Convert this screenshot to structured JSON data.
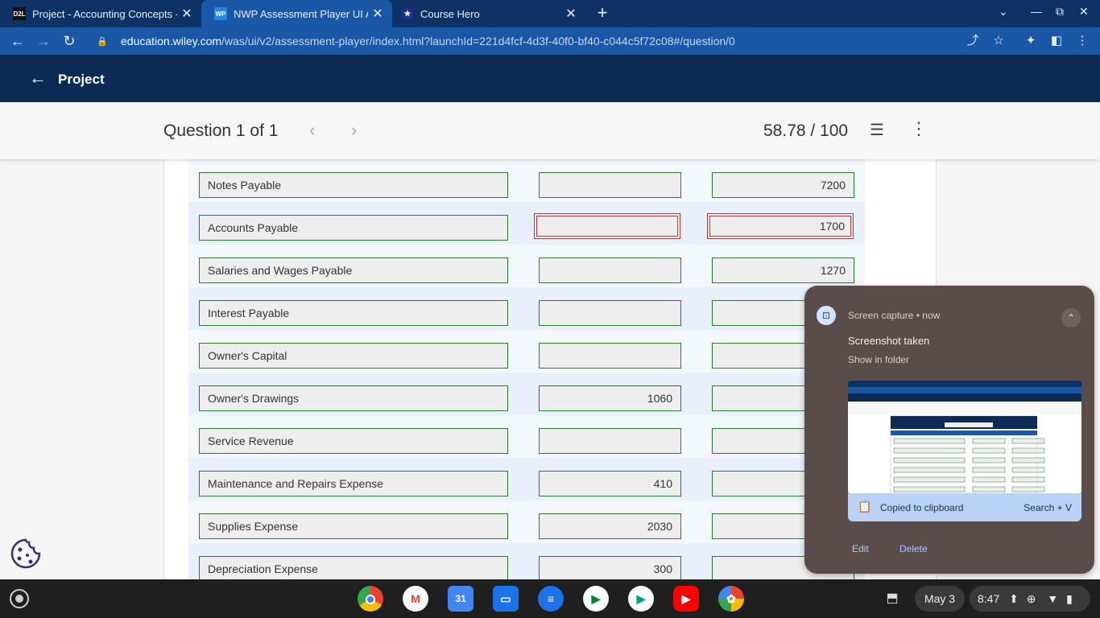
{
  "browser": {
    "tabs": [
      {
        "favicon": "D2L",
        "title": "Project - Accounting Concepts - ",
        "active": false
      },
      {
        "favicon": "WP",
        "title": "NWP Assessment Player UI App",
        "active": true
      },
      {
        "favicon": "★",
        "title": "Course Hero",
        "active": false
      }
    ],
    "url_host": "education.wiley.com",
    "url_path": "/was/ui/v2/assessment-player/index.html?launchId=221d4fcf-4d3f-40f0-bf40-c044c5f72c08#/question/0"
  },
  "app": {
    "title": "Project"
  },
  "question": {
    "label": "Question 1 of 1",
    "score": "58.78 / 100"
  },
  "trial_balance": {
    "rows": [
      {
        "account": "Notes Payable",
        "debit": "",
        "credit": "7200",
        "error": false
      },
      {
        "account": "Accounts Payable",
        "debit": "",
        "credit": "1700",
        "error": true
      },
      {
        "account": "Salaries and Wages Payable",
        "debit": "",
        "credit": "1270",
        "error": false
      },
      {
        "account": "Interest Payable",
        "debit": "",
        "credit": "",
        "error": false
      },
      {
        "account": "Owner's Capital",
        "debit": "",
        "credit": "",
        "error": false
      },
      {
        "account": "Owner's Drawings",
        "debit": "1060",
        "credit": "",
        "error": false
      },
      {
        "account": "Service Revenue",
        "debit": "",
        "credit": "",
        "error": false
      },
      {
        "account": "Maintenance and Repairs Expense",
        "debit": "410",
        "credit": "",
        "error": false
      },
      {
        "account": "Supplies Expense",
        "debit": "2030",
        "credit": "",
        "error": false
      },
      {
        "account": "Depreciation Expense",
        "debit": "300",
        "credit": "",
        "error": false
      }
    ]
  },
  "notification": {
    "source": "Screen capture",
    "time": "now",
    "heading": "Screenshot taken",
    "subtext": "Show in folder",
    "clipboard_label": "Copied to clipboard",
    "shortcut": "Search + V",
    "edit_label": "Edit",
    "delete_label": "Delete"
  },
  "shelf": {
    "apps": [
      "chrome",
      "gmail",
      "calendar",
      "files",
      "messages",
      "meet",
      "play-store",
      "youtube",
      "photos"
    ],
    "calendar_day": "31",
    "date": "May 3",
    "time": "8:47"
  },
  "colors": {
    "tab_strip": "#0d3366",
    "toolbar": "#1a57a6",
    "app_header": "#0b2b54",
    "field_border": "#2f7a2f",
    "error_border": "#b53a3a",
    "notification_bg": "#5a4c4a",
    "clipboard_bar": "#b9d2f5"
  }
}
